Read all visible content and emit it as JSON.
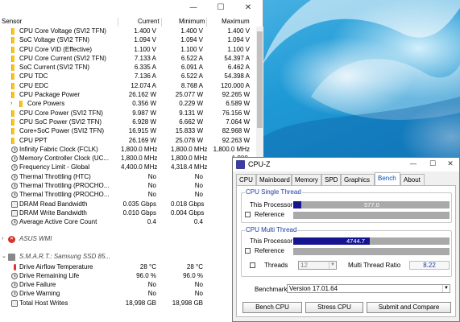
{
  "hwinfo": {
    "titlebar": {
      "minimize": "—",
      "maximize": "☐",
      "close": "✕"
    },
    "columns": {
      "sensor": "Sensor",
      "current": "Current",
      "minimum": "Minimum",
      "maximum": "Maximum"
    },
    "rows": [
      {
        "name": "CPU Core Voltage (SVI2 TFN)",
        "current": "1.400 V",
        "minimum": "1.400 V",
        "maximum": "1.400 V",
        "icon": "bolt-icon"
      },
      {
        "name": "SoC Voltage (SVI2 TFN)",
        "current": "1.094 V",
        "minimum": "1.094 V",
        "maximum": "1.094 V",
        "icon": "bolt-icon"
      },
      {
        "name": "CPU Core VID (Effective)",
        "current": "1.100 V",
        "minimum": "1.100 V",
        "maximum": "1.100 V",
        "icon": "bolt-icon"
      },
      {
        "name": "CPU Core Current (SVI2 TFN)",
        "current": "7.133 A",
        "minimum": "6.522 A",
        "maximum": "54.397 A",
        "icon": "bolt-icon"
      },
      {
        "name": "SoC Current (SVI2 TFN)",
        "current": "6.335 A",
        "minimum": "6.091 A",
        "maximum": "6.462 A",
        "icon": "bolt-icon"
      },
      {
        "name": "CPU TDC",
        "current": "7.136 A",
        "minimum": "6.522 A",
        "maximum": "54.398 A",
        "icon": "bolt-icon"
      },
      {
        "name": "CPU EDC",
        "current": "12.074 A",
        "minimum": "8.768 A",
        "maximum": "120.000 A",
        "icon": "bolt-icon"
      },
      {
        "name": "CPU Package Power",
        "current": "26.162 W",
        "minimum": "25.077 W",
        "maximum": "92.265 W",
        "icon": "bolt-icon"
      },
      {
        "name": "Core Powers",
        "current": "0.356 W",
        "minimum": "0.229 W",
        "maximum": "6.589 W",
        "icon": "bolt-icon",
        "expandable": true
      },
      {
        "name": "CPU Core Power (SVI2 TFN)",
        "current": "9.987 W",
        "minimum": "9.131 W",
        "maximum": "76.156 W",
        "icon": "bolt-icon"
      },
      {
        "name": "CPU SoC Power (SVI2 TFN)",
        "current": "6.928 W",
        "minimum": "6.662 W",
        "maximum": "7.064 W",
        "icon": "bolt-icon"
      },
      {
        "name": "Core+SoC Power (SVI2 TFN)",
        "current": "16.915 W",
        "minimum": "15.833 W",
        "maximum": "82.968 W",
        "icon": "bolt-icon"
      },
      {
        "name": "CPU PPT",
        "current": "26.169 W",
        "minimum": "25.078 W",
        "maximum": "92.263 W",
        "icon": "bolt-icon"
      },
      {
        "name": "Infinity Fabric Clock (FCLK)",
        "current": "1,800.0 MHz",
        "minimum": "1,800.0 MHz",
        "maximum": "1,800.0 MHz",
        "icon": "clock-icon"
      },
      {
        "name": "Memory Controller Clock (UC...",
        "current": "1,800.0 MHz",
        "minimum": "1,800.0 MHz",
        "maximum": "1,800.",
        "icon": "clock-icon"
      },
      {
        "name": "Frequency Limit - Global",
        "current": "4,400.0 MHz",
        "minimum": "4,318.4 MHz",
        "maximum": "4,400.",
        "icon": "clock-icon"
      },
      {
        "name": "Thermal Throttling (HTC)",
        "current": "No",
        "minimum": "No",
        "maximum": "",
        "icon": "gauge-icon"
      },
      {
        "name": "Thermal Throttling (PROCHO...",
        "current": "No",
        "minimum": "No",
        "maximum": "",
        "icon": "gauge-icon"
      },
      {
        "name": "Thermal Throttling (PROCHO...",
        "current": "No",
        "minimum": "No",
        "maximum": "",
        "icon": "gauge-icon"
      },
      {
        "name": "DRAM Read Bandwidth",
        "current": "0.035 Gbps",
        "minimum": "0.018 Gbps",
        "maximum": "0.75",
        "icon": "disk-icon"
      },
      {
        "name": "DRAM Write Bandwidth",
        "current": "0.010 Gbps",
        "minimum": "0.004 Gbps",
        "maximum": "0.25",
        "icon": "disk-icon"
      },
      {
        "name": "Average Active Core Count",
        "current": "0.4",
        "minimum": "0.4",
        "maximum": "",
        "icon": "gauge-icon"
      }
    ],
    "group_asus": {
      "name": "ASUS WMI",
      "expander": "›"
    },
    "group_smart": {
      "name": "S.M.A.R.T.: Samsung SSD 85...",
      "expander": "⌄"
    },
    "smart_rows": [
      {
        "name": "Drive Airflow Temperature",
        "current": "28 °C",
        "minimum": "28 °C",
        "maximum": "",
        "icon": "thermometer-icon"
      },
      {
        "name": "Drive Remaining Life",
        "current": "96.0 %",
        "minimum": "96.0 %",
        "maximum": "9",
        "icon": "gauge-icon"
      },
      {
        "name": "Drive Failure",
        "current": "No",
        "minimum": "No",
        "maximum": "",
        "icon": "gauge-icon"
      },
      {
        "name": "Drive Warning",
        "current": "No",
        "minimum": "No",
        "maximum": "",
        "icon": "gauge-icon"
      },
      {
        "name": "Total Host Writes",
        "current": "18,998 GB",
        "minimum": "18,998 GB",
        "maximum": "18,",
        "icon": "disk-icon"
      }
    ]
  },
  "cpuz": {
    "title": "CPU-Z",
    "titlebar": {
      "minimize": "—",
      "maximize": "☐",
      "close": "✕"
    },
    "tabs": [
      "CPU",
      "Mainboard",
      "Memory",
      "SPD",
      "Graphics",
      "Bench",
      "About"
    ],
    "active_tab": "Bench",
    "single_thread": {
      "legend": "CPU Single Thread",
      "this_processor_label": "This Processor",
      "this_processor_value": "577.0",
      "this_processor_fraction": 0.05,
      "reference_label": "Reference"
    },
    "multi_thread": {
      "legend": "CPU Multi Thread",
      "this_processor_label": "This Processor",
      "this_processor_value": "4744.7",
      "this_processor_fraction": 0.49,
      "reference_label": "Reference",
      "threads_label": "Threads",
      "threads_value": "12",
      "ratio_label": "Multi Thread Ratio",
      "ratio_value": "8.22"
    },
    "benchmark_label": "Benchmark",
    "benchmark_value": "Version 17.01.64",
    "buttons": {
      "bench_cpu": "Bench CPU",
      "stress_cpu": "Stress CPU",
      "submit": "Submit and Compare"
    },
    "colors": {
      "bar_fill": "#16158f",
      "bar_bg": "#a9a9a9",
      "legend": "#1a3ea3"
    }
  }
}
